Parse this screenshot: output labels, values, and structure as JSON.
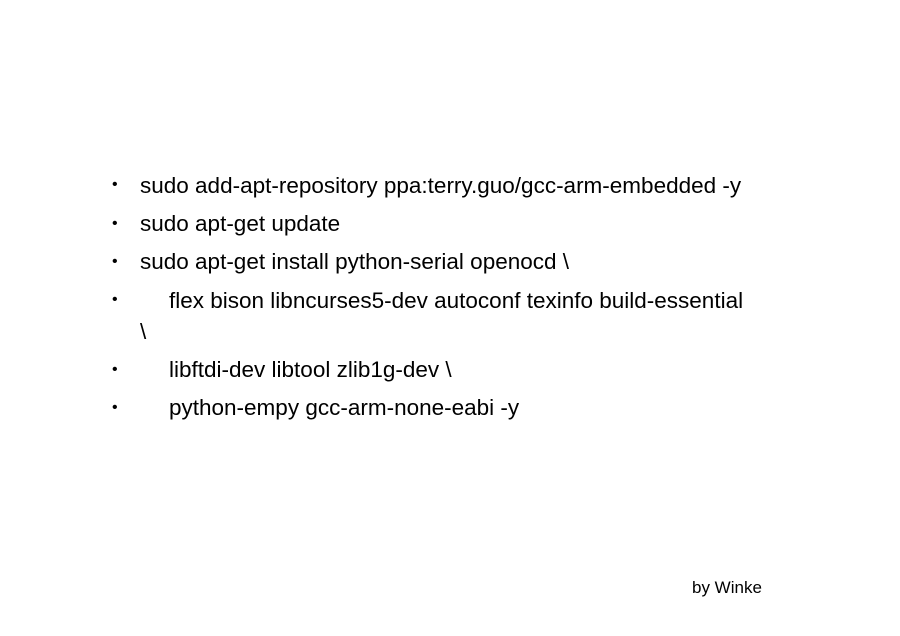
{
  "slide": {
    "bullet_symbol": "•",
    "bullets": [
      {
        "text": "sudo add-apt-repository ppa:terry.guo/gcc-arm-embedded -y"
      },
      {
        "text": "sudo apt-get update"
      },
      {
        "text": "sudo apt-get install python-serial openocd \\"
      },
      {
        "text": "flex bison libncurses5-dev autoconf texinfo build-essential \\"
      },
      {
        "text": "libftdi-dev libtool zlib1g-dev \\"
      },
      {
        "text": "python-empy gcc-arm-none-eabi -y"
      }
    ],
    "author": "by Winke"
  }
}
